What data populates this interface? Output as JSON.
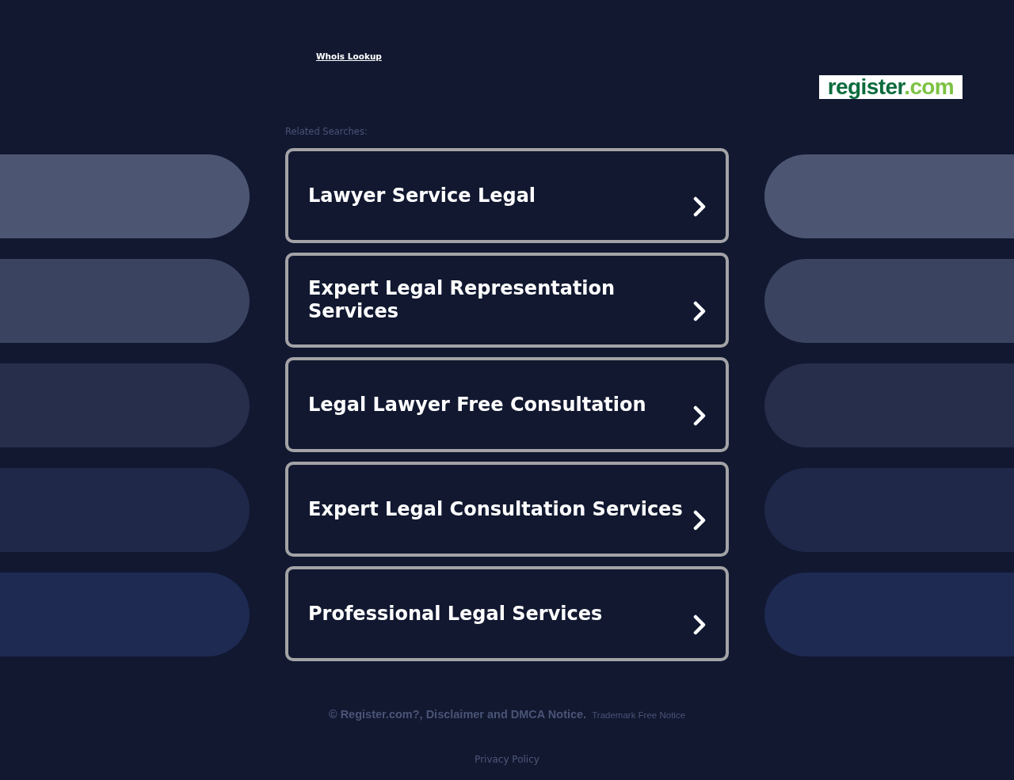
{
  "header": {
    "whois_link": "Whois Lookup",
    "logo": {
      "name": "register",
      "suffix": ".com"
    }
  },
  "related": {
    "heading": "Related Searches:",
    "searches": [
      "Lawyer Service Legal",
      "Expert Legal Representation Services",
      "Legal Lawyer Free Consultation",
      "Expert Legal Consultation Services",
      "Professional Legal Services"
    ]
  },
  "footer": {
    "copyright": "© Register.com?, Disclaimer and DMCA Notice.",
    "trademark": "Trademark Free Notice",
    "privacy": "Privacy Policy"
  }
}
